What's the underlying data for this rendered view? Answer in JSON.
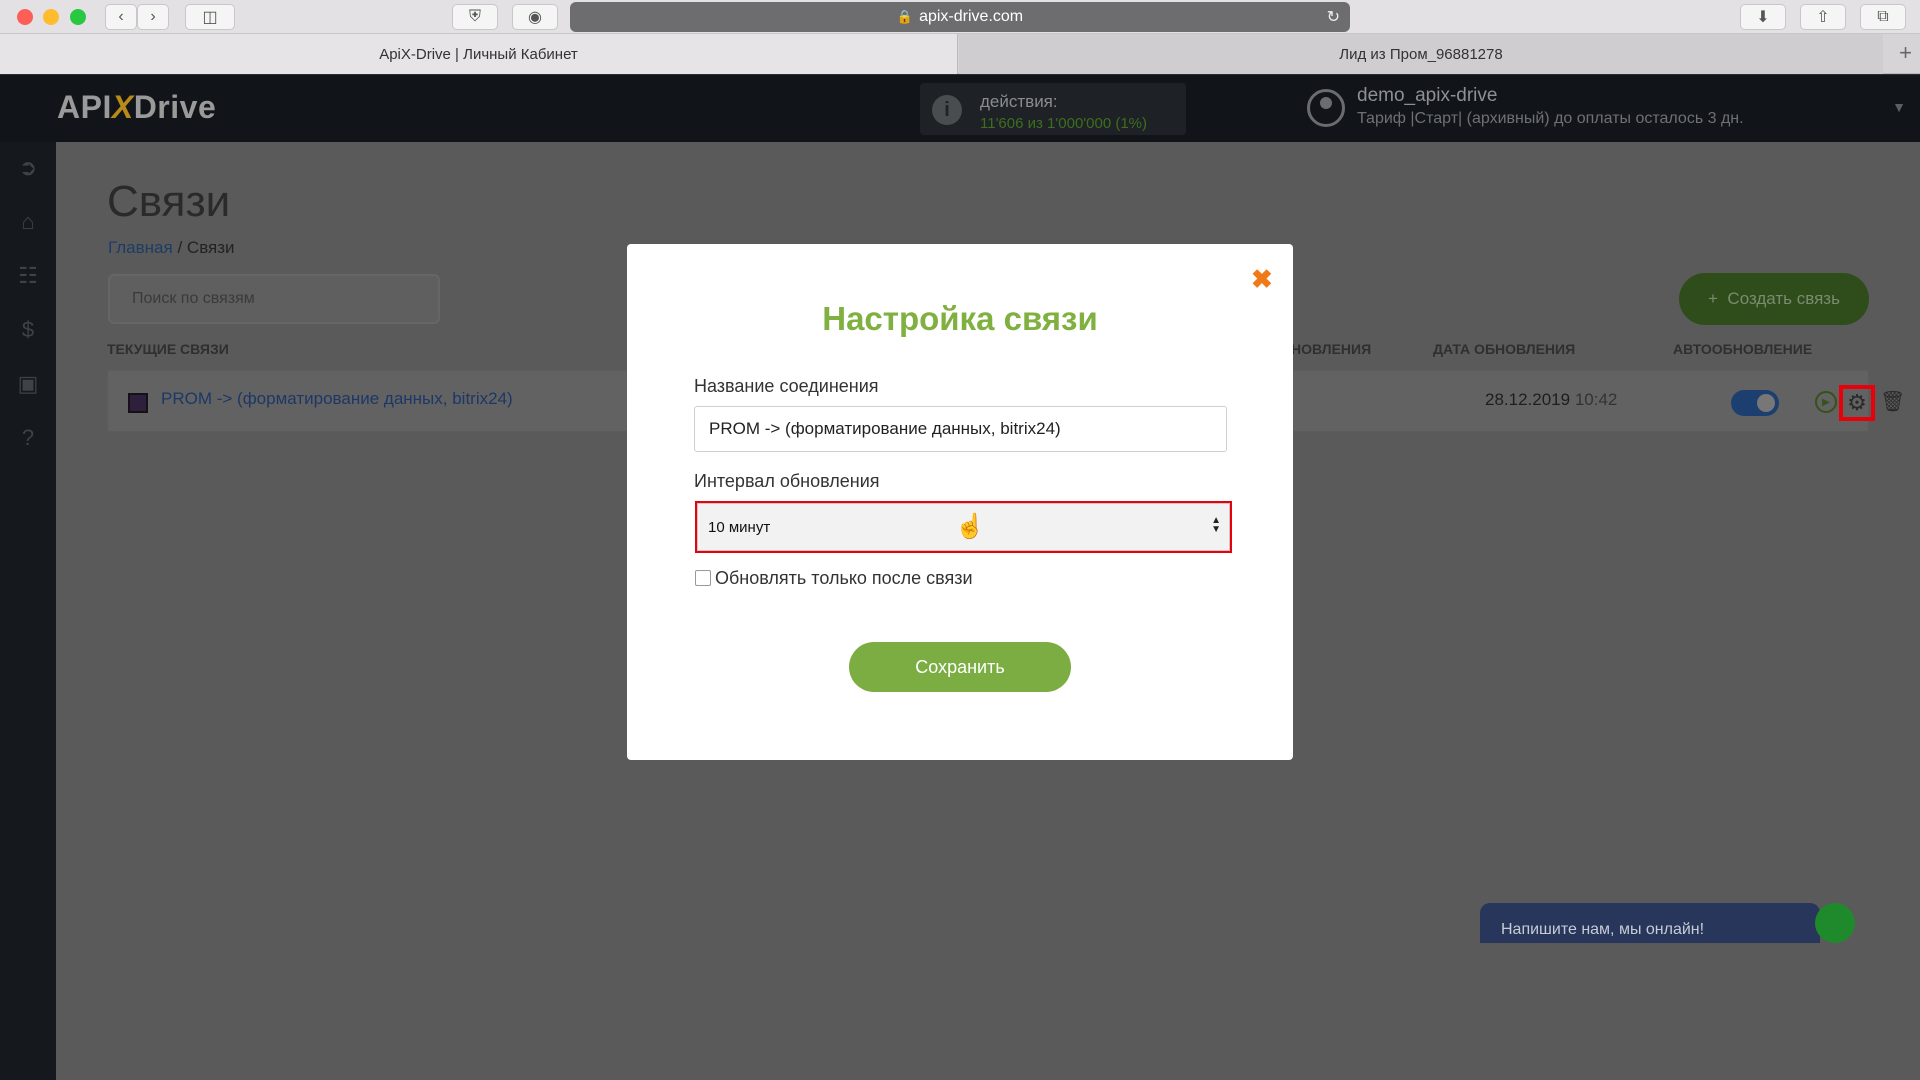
{
  "browser": {
    "url": "apix-drive.com",
    "tabs": [
      {
        "title": "ApiX-Drive | Личный Кабинет"
      },
      {
        "title": "Лид из Пром_96881278"
      }
    ]
  },
  "header": {
    "logo_left": "API",
    "logo_x": "X",
    "logo_right": "Drive",
    "actions_label": "действия:",
    "actions_value": "11'606 из 1'000'000 (1%)",
    "user_name": "demo_apix-drive",
    "user_tariff": "Тариф |Старт| (архивный) до оплаты осталось 3 дн."
  },
  "page": {
    "title": "Связи",
    "breadcrumb_home": "Главная",
    "breadcrumb_sep": "/",
    "breadcrumb_current": "Связи",
    "search_placeholder": "Поиск по связям",
    "create_button": "Создать связь",
    "columns": {
      "current": "ТЕКУЩИЕ СВЯЗИ",
      "update_partial": "НОВЛЕНИЯ",
      "update_date": "ДАТА ОБНОВЛЕНИЯ",
      "autoupdate": "АВТООБНОВЛЕНИЕ"
    },
    "rows": [
      {
        "name": "PROM -> (форматирование данных, bitrix24)",
        "date": "28.12.2019",
        "time": "10:42"
      }
    ]
  },
  "chat": {
    "text": "Напишите нам, мы онлайн!"
  },
  "modal": {
    "title": "Настройка связи",
    "name_label": "Название соединения",
    "name_value": "PROM -> (форматирование данных, bitrix24)",
    "interval_label": "Интервал обновления",
    "interval_value": "10 минут",
    "checkbox_label": "Обновлять только после связи",
    "save_button": "Сохранить"
  },
  "colors": {
    "accent_green": "#7bad42",
    "title_green": "#7fb040",
    "highlight_red": "#e8000b",
    "close_orange": "#f07a18"
  }
}
